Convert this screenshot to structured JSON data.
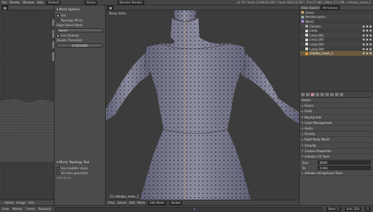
{
  "topbar": {
    "menus": [
      "File",
      "Render",
      "Window",
      "Help"
    ],
    "layout": "Default",
    "scene": "Scene",
    "engine": "Blender Render",
    "info": "v2.79 | Verts:3,034/14,487 | Faces:502/13,287 | Tris:27,362 | Mem:15.15M | shikabu_mesh_1"
  },
  "uv": {
    "menus": [
      "View",
      "Select",
      "Image",
      "UVs"
    ],
    "editor_label": "View",
    "select_label": "Select",
    "image_label": "Image",
    "uvs_label": "UVs"
  },
  "tools": {
    "section": "Mesh Options",
    "uv_label": "UVs",
    "mirror_label": "Mirror",
    "mirror_value": "Topology Mirror",
    "edge_select_label": "Edge Select Mode",
    "edge_select_value": "Select",
    "live_unwrap": "Live Unwrap",
    "double_threshold_label": "Double Threshold",
    "double_threshold": "0.0010000",
    "bottom_section": "Mirror Topology Tool",
    "bottom_items": [
      "Use modifier stack",
      "UV color geometry"
    ],
    "bottom_status": "Edit Mode"
  },
  "viewport": {
    "view_label": "Persp Ortho",
    "object_label": "(1) shikabu_mesh_1",
    "menus": [
      "View",
      "Select",
      "Add",
      "Mesh"
    ],
    "mode": "Edit Mode",
    "pivot": "Global"
  },
  "outliner": {
    "menus": [
      "View",
      "Search"
    ],
    "scene_filter": "All Scenes",
    "rows": [
      {
        "name": "Scene",
        "color": "#c9a66b"
      },
      {
        "name": "RenderLayers",
        "color": "#9aa"
      },
      {
        "name": "World",
        "color": "#a8c"
      },
      {
        "name": "Camera",
        "color": "#aaa"
      },
      {
        "name": "Lamp",
        "color": "#ddd"
      },
      {
        "name": "Lamp.001",
        "color": "#ddd"
      },
      {
        "name": "Lamp.002",
        "color": "#ddd"
      },
      {
        "name": "Lamp.003",
        "color": "#ddd"
      },
      {
        "name": "Lamp.004",
        "color": "#ddd"
      },
      {
        "name": "shikabu_mesh_1",
        "color": "#e69a3a"
      }
    ]
  },
  "props": {
    "title": "Scene",
    "sections": [
      {
        "name": "Scene",
        "open": false
      },
      {
        "name": "Units",
        "open": false
      },
      {
        "name": "Keying Sets",
        "open": false
      },
      {
        "name": "Color Management",
        "open": false
      },
      {
        "name": "Audio",
        "open": false
      },
      {
        "name": "Gravity",
        "open": false
      },
      {
        "name": "Rigid Body World",
        "open": false
      },
      {
        "name": "Simplify",
        "open": false
      },
      {
        "name": "Custom Properties",
        "open": false
      },
      {
        "name": "shikabu CIS Tools",
        "open": true
      }
    ],
    "type_label": "Type",
    "type_value": "BRDF",
    "tol_label": "Tol",
    "tol_value": "0.001",
    "last_section": "shikabu shirogitsune Tools"
  },
  "status": {
    "menus": [
      "View",
      "Marker",
      "Frame",
      "Playback"
    ],
    "start": "Start",
    "start_val": "1",
    "end": "End",
    "end_val": "250",
    "frame": "1"
  },
  "colors": {
    "accent": "#e69a3a",
    "mesh": "#8d8da8",
    "wire": "#111",
    "selected_edge": "#e6b050"
  }
}
